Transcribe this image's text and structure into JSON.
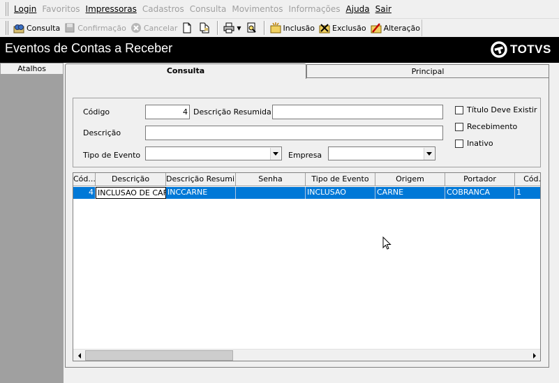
{
  "menu": {
    "items": [
      {
        "label": "Login",
        "enabled": true
      },
      {
        "label": "Favoritos",
        "enabled": false
      },
      {
        "label": "Impressoras",
        "enabled": true
      },
      {
        "label": "Cadastros",
        "enabled": false
      },
      {
        "label": "Consulta",
        "enabled": false
      },
      {
        "label": "Movimentos",
        "enabled": false
      },
      {
        "label": "Informações",
        "enabled": false
      },
      {
        "label": "Ajuda",
        "enabled": true
      },
      {
        "label": "Sair",
        "enabled": true
      }
    ]
  },
  "toolbar": {
    "consulta": "Consulta",
    "confirmacao": "Confirmação",
    "cancelar": "Cancelar",
    "inclusao": "Inclusão",
    "exclusao": "Exclusão",
    "alteracao": "Alteração"
  },
  "window": {
    "title": "Eventos de Contas a Receber",
    "logo": "TOTVS"
  },
  "sidebar": {
    "tab_label": "Atalhos"
  },
  "tabs": {
    "consulta": "Consulta",
    "principal": "Principal"
  },
  "form": {
    "codigo_label": "Código",
    "codigo_value": "4",
    "descricao_resumida_label": "Descrição Resumida",
    "descricao_resumida_value": "",
    "descricao_label": "Descrição",
    "descricao_value": "",
    "tipo_evento_label": "Tipo de Evento",
    "tipo_evento_value": "",
    "empresa_label": "Empresa",
    "empresa_value": "",
    "titulo_deve_existir_label": "Título Deve Existir",
    "recebimento_label": "Recebimento",
    "inativo_label": "Inativo"
  },
  "grid": {
    "columns": [
      "Cód...",
      "Descrição",
      "Descrição Resumi...",
      "Senha",
      "Tipo de Evento",
      "Origem",
      "Portador",
      "Cód."
    ],
    "rows": [
      [
        "4",
        "INCLUSAO DE CAF",
        "INCCARNE",
        "",
        "INCLUSAO",
        "CARNE",
        "COBRANCA",
        "1"
      ]
    ]
  },
  "colors": {
    "selection": "#0078d7",
    "title_bg": "#000000",
    "sidebar_bg": "#a0a0a0"
  }
}
